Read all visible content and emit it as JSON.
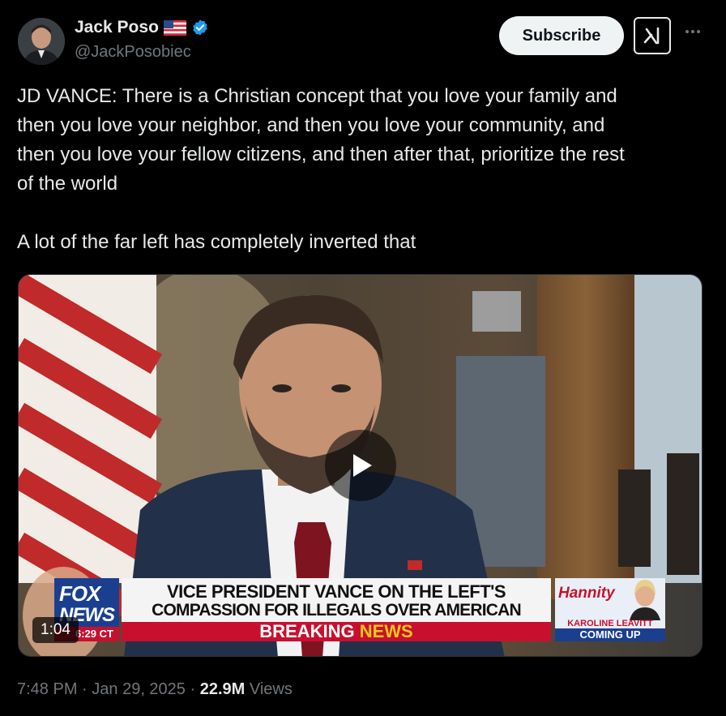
{
  "author": {
    "display_name": "Jack Poso",
    "handle": "@JackPosobiec",
    "flag_icon": "us-flag-icon",
    "verified_icon": "verified-badge-icon",
    "verified_color": "#1d9bf0"
  },
  "header": {
    "subscribe_label": "Subscribe",
    "grok_icon": "grok-icon",
    "more_icon": "more-icon"
  },
  "tweet": {
    "text": "JD VANCE: There is a Christian concept that you love your family and\nthen you love your neighbor, and then you love your community, and\nthen you love your fellow citizens, and then after that, prioritize the rest\nof the world\n\nA lot of the far left has completely inverted that"
  },
  "video": {
    "duration": "1:04",
    "play_icon": "play-icon",
    "chyron": {
      "network_line1": "FOX",
      "network_line2": "NEWS",
      "time": "6:29 CT",
      "headline_line1": "VICE PRESIDENT VANCE ON THE LEFT'S",
      "headline_line2": "COMPASSION FOR ILLEGALS OVER AMERICAN CITIZENS",
      "breaking_word1": "BREAKING",
      "breaking_word2": "NEWS",
      "promo_show": "Hannity",
      "promo_name": "KAROLINE LEAVITT",
      "promo_status": "COMING UP"
    }
  },
  "meta": {
    "time": "7:48 PM",
    "separator": " · ",
    "date": "Jan 29, 2025",
    "views_count": "22.9M",
    "views_label": "Views"
  }
}
